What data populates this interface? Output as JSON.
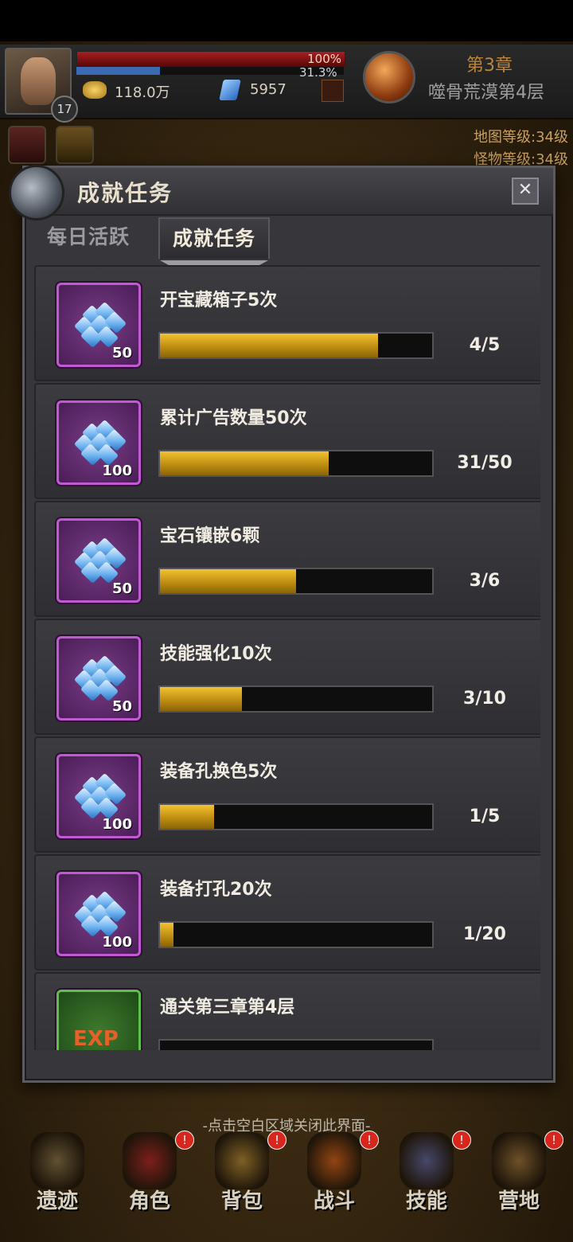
{
  "hud": {
    "hp_percent": "100%",
    "exp_percent": "31.3%",
    "level": "17",
    "gold": "118.0万",
    "gems": "5957",
    "chapter": "第3章",
    "stage": "噬骨荒漠第4层",
    "map_level": "地图等级:34级",
    "monster_level": "怪物等级:34级"
  },
  "dialog": {
    "title": "成就任务",
    "close": "✕",
    "tabs": [
      {
        "label": "每日活跃",
        "active": false
      },
      {
        "label": "成就任务",
        "active": true
      }
    ],
    "quests": [
      {
        "title": "开宝藏箱子5次",
        "reward": "50",
        "progress": "4/5",
        "fraction": 0.8,
        "reward_type": "gem"
      },
      {
        "title": "累计广告数量50次",
        "reward": "100",
        "progress": "31/50",
        "fraction": 0.62,
        "reward_type": "gem"
      },
      {
        "title": "宝石镶嵌6颗",
        "reward": "50",
        "progress": "3/6",
        "fraction": 0.5,
        "reward_type": "gem"
      },
      {
        "title": "技能强化10次",
        "reward": "50",
        "progress": "3/10",
        "fraction": 0.3,
        "reward_type": "gem"
      },
      {
        "title": "装备孔换色5次",
        "reward": "100",
        "progress": "1/5",
        "fraction": 0.2,
        "reward_type": "gem"
      },
      {
        "title": "装备打孔20次",
        "reward": "100",
        "progress": "1/20",
        "fraction": 0.05,
        "reward_type": "gem"
      },
      {
        "title": "通关第三章第4层",
        "reward": "EXP",
        "progress": "",
        "fraction": 0,
        "reward_type": "exp"
      }
    ]
  },
  "hint": "-点击空白区域关闭此界面-",
  "nav": [
    {
      "label": "遗迹",
      "badge": "",
      "color": "#6a5a3a"
    },
    {
      "label": "角色",
      "badge": "!",
      "color": "#8a1e1e"
    },
    {
      "label": "背包",
      "badge": "!",
      "color": "#8a6a2a"
    },
    {
      "label": "战斗",
      "badge": "!",
      "color": "#a24a12"
    },
    {
      "label": "技能",
      "badge": "!",
      "color": "#4a4e7a"
    },
    {
      "label": "营地",
      "badge": "!",
      "color": "#7a5a2e"
    }
  ]
}
